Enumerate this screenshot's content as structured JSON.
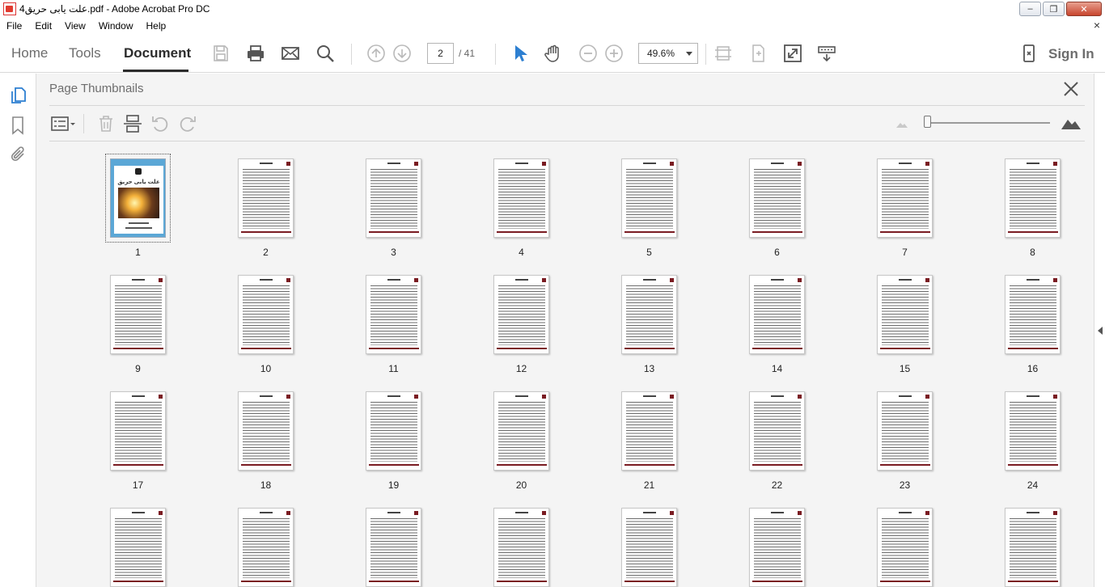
{
  "window": {
    "title": "علت یابی حریق4.pdf - Adobe Acrobat Pro DC",
    "controls": {
      "minimize": "–",
      "maximize": "❐",
      "close": "✕"
    }
  },
  "menu": {
    "items": [
      "File",
      "Edit",
      "View",
      "Window",
      "Help"
    ],
    "close": "×"
  },
  "toolbar": {
    "tabs": {
      "home": "Home",
      "tools": "Tools",
      "document": "Document"
    },
    "page_current": "2",
    "page_total": "/ 41",
    "zoom": "49.6%",
    "sign_in": "Sign In"
  },
  "panel": {
    "title": "Page Thumbnails",
    "selected_page": 1,
    "cover_title": "علت یابی حریق"
  },
  "thumbnails": [
    {
      "label": "1"
    },
    {
      "label": "2"
    },
    {
      "label": "3"
    },
    {
      "label": "4"
    },
    {
      "label": "5"
    },
    {
      "label": "6"
    },
    {
      "label": "7"
    },
    {
      "label": "8"
    },
    {
      "label": "9"
    },
    {
      "label": "10"
    },
    {
      "label": "11"
    },
    {
      "label": "12"
    },
    {
      "label": "13"
    },
    {
      "label": "14"
    },
    {
      "label": "15"
    },
    {
      "label": "16"
    },
    {
      "label": "17"
    },
    {
      "label": "18"
    },
    {
      "label": "19"
    },
    {
      "label": "20"
    },
    {
      "label": "21"
    },
    {
      "label": "22"
    },
    {
      "label": "23"
    },
    {
      "label": "24"
    },
    {
      "label": ""
    },
    {
      "label": ""
    },
    {
      "label": ""
    },
    {
      "label": ""
    },
    {
      "label": ""
    },
    {
      "label": ""
    },
    {
      "label": ""
    },
    {
      "label": ""
    }
  ],
  "colors": {
    "accent_blue": "#2d7fd1",
    "text_dark": "#2c2c2c",
    "text_muted": "#6d6d6d",
    "cover_blue": "#5ba7d6",
    "footer_red": "#7a1c22"
  }
}
